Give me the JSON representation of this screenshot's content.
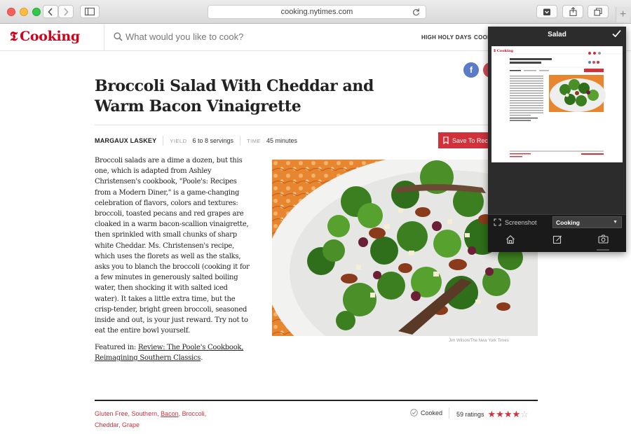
{
  "browser": {
    "url": "cooking.nytimes.com",
    "new_tab_glyph": "+",
    "icons": [
      "back-icon",
      "forward-icon",
      "sidebar-icon",
      "reload-icon",
      "pocket-icon",
      "share-icon",
      "tabs-icon"
    ]
  },
  "site": {
    "logo_mark": "𝕿",
    "logo_text": "Cooking",
    "search_placeholder": "What would you like to cook?",
    "nav": [
      "HIGH HOLY DAYS",
      "COOK"
    ]
  },
  "social": {
    "facebook_glyph": "f"
  },
  "recipe": {
    "title": "Broccoli Salad With Cheddar and Warm Bacon Vinaigrette",
    "author": "MARGAUX LASKEY",
    "yield_label": "YIELD",
    "yield_value": "6 to 8 servings",
    "time_label": "TIME",
    "time_value": "45 minutes",
    "save_label": "Save To Reci",
    "description": "Broccoli salads are a dime a dozen, but this one, which is adapted from Ashley Christensen's cookbook, \"Poole's: Recipes from a Modern Diner,\" is a game-changing celebration of flavors, colors and textures: broccoli, toasted pecans and red grapes are cloaked in a warm bacon-scallion vinaigrette, then sprinkled with small chunks of sharp white Cheddar. Ms. Christensen's recipe, which uses the florets as well as the stalks, asks you to blanch the broccoli (cooking it for a few minutes in generously salted boiling water, then shocking it with salted iced water). It takes a little extra time, but the crisp-tender, bright green broccoli, seasoned inside and out, is your just reward. Try not to eat the entire bowl yourself.",
    "featured_prefix": "Featured in: ",
    "featured_link": "Review: The Poole's Cookbook, Reimagining Southern Classics",
    "featured_suffix": ".",
    "photo_credit": "Jim Wilson/The New York Times",
    "tags": [
      "Gluten Free",
      "Southern",
      "Bacon",
      "Broccoli",
      "Cheddar",
      "Grape"
    ],
    "cooked_label": "Cooked",
    "ratings_label": "59 ratings",
    "stars_filled": 4,
    "stars_total": 5
  },
  "share_panel": {
    "title": "Salad",
    "screenshot_label": "Screenshot",
    "dropdown_value": "Cooking",
    "tabs": [
      "home-icon",
      "edit-icon",
      "camera-icon"
    ]
  },
  "colors": {
    "brand_red": "#d0021b",
    "accent_red": "#d0313b",
    "facebook_blue": "#5a7cc8",
    "panel_bg": "#2c2c2c"
  }
}
